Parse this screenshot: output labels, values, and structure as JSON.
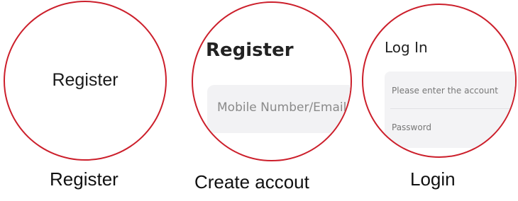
{
  "panels": [
    {
      "screen": {
        "button_label": "Register"
      },
      "caption": "Register"
    },
    {
      "screen": {
        "title": "Register",
        "input_placeholder": "Mobile Number/Email"
      },
      "caption": "Create accout"
    },
    {
      "screen": {
        "title": "Log In",
        "account_placeholder": "Please enter the account",
        "password_placeholder": "Password"
      },
      "caption": "Login"
    }
  ],
  "colors": {
    "circle_border": "#cc1f2b",
    "field_background": "#f2f2f4"
  }
}
